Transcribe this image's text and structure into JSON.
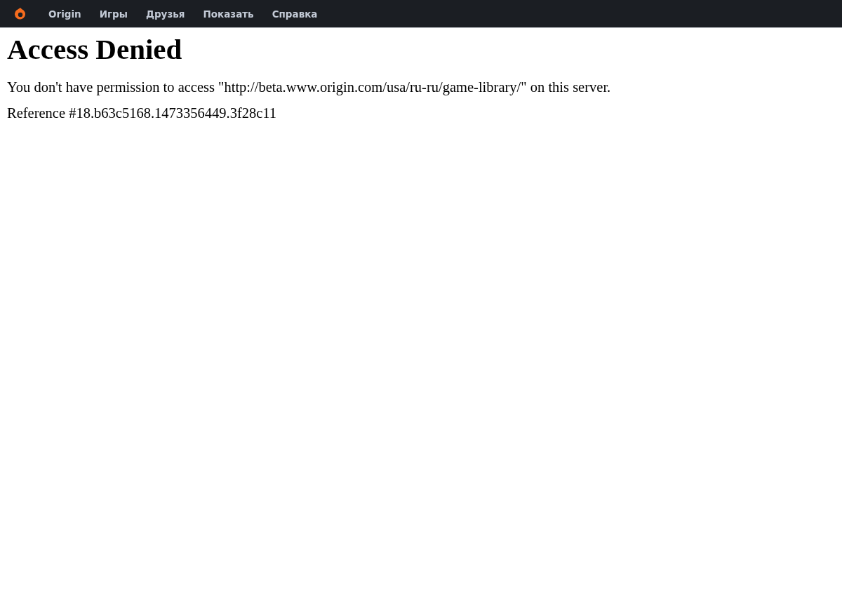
{
  "menu_bar": {
    "items": [
      {
        "label": "Origin"
      },
      {
        "label": "Игры"
      },
      {
        "label": "Друзья"
      },
      {
        "label": "Показать"
      },
      {
        "label": "Справка"
      }
    ]
  },
  "page": {
    "title": "Access Denied",
    "message": "You don't have permission to access \"http://beta.www.origin.com/usa/ru-ru/game-library/\" on this server.",
    "reference": "Reference #18.b63c5168.1473356449.3f28c11"
  }
}
